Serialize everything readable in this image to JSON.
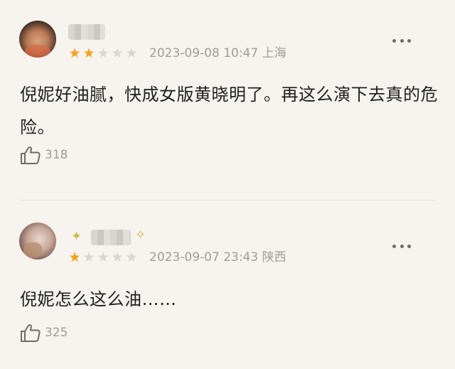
{
  "reviews": [
    {
      "rating": {
        "filled": 2,
        "total": 5
      },
      "date": "2023-09-08 10:47",
      "location": "上海",
      "text": "倪妮好油腻，快成女版黄晓明了。再这么演下去真的危险。",
      "likes": "318"
    },
    {
      "rating": {
        "filled": 1,
        "total": 5
      },
      "date": "2023-09-07 23:43",
      "location": "陕西",
      "text": "倪妮怎么这么油……",
      "likes": "325"
    }
  ],
  "colors": {
    "background": "#f7f3ee",
    "star_on": "#f2a11a",
    "star_off": "#d9d5d0",
    "meta_text": "#9f9b97",
    "body_text": "#1f1f1f"
  },
  "icons": {
    "like": "thumbs-up-icon",
    "more": "more-icon",
    "star": "star-icon"
  }
}
